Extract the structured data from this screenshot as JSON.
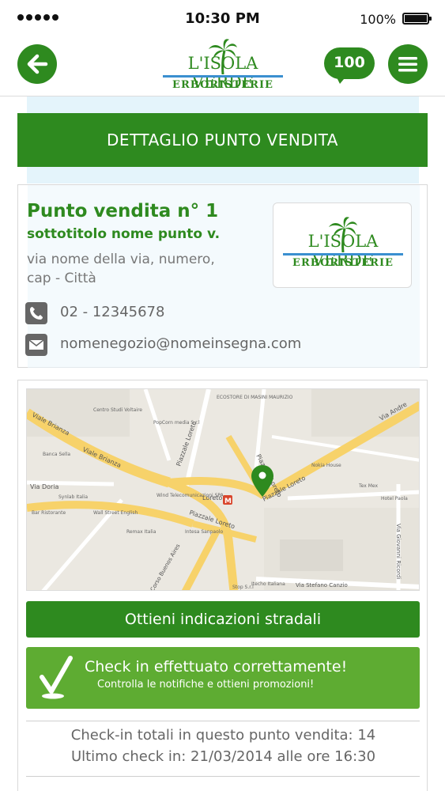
{
  "status_bar": {
    "time": "10:30 PM",
    "battery": "100%"
  },
  "header": {
    "brand_top": "L'ISOLA VERDE",
    "brand_bottom": "ERBORISTERIE",
    "notification_count": "100"
  },
  "page": {
    "title": "DETTAGLIO PUNTO VENDITA"
  },
  "store": {
    "name": "Punto vendita n° 1",
    "subtitle": "sottotitolo nome punto v.",
    "address_line1": "via nome della via, numero,",
    "address_line2": "cap - Città",
    "phone": "02 - 12345678",
    "email": "nomenegozio@nomeinsegna.com"
  },
  "map": {
    "labels": {
      "viale_brianza": "Viale Brianza",
      "viale_brianza_2": "Viale Brianza",
      "via_andrea": "Via Andre",
      "piazzale_loreto": "Piazzale Loreto",
      "piazzale_loreto_2": "Piazzale Loreto",
      "piazzale_loreto_3": "Piazzale Loreto",
      "piazzale_loreto_4": "Piazzale Loreto",
      "loreto": "Loreto",
      "via_doria": "Via Doria",
      "corso_buenos_aires": "Corso Buenos Aires",
      "via_giovanni_ricordi": "Via Giovanni Ricordi",
      "via_stefano_canzio": "Via Stefano Canzio",
      "centro_studi": "Centro Studi Voltaire",
      "hotel_paola": "Hotel Paola",
      "tex_mex": "Tex Mex",
      "wall_street": "Wall Street English",
      "banca_sella": "Banca Sella",
      "intesa": "Intesa Sanpaolo",
      "popcorn": "PopCorn media S.r.l",
      "ecostore": "ECOSTORE DI MASINI MAURIZIO",
      "synlab": "Synlab Italia",
      "bar_ristorante": "Bar Ristorante",
      "remax": "Remax Italia",
      "wind": "Wind Telecomunicazioni SPA",
      "nokia": "Nokia House",
      "stop": "Stop S.r.l",
      "itecho": "Itecho Italiana",
      "metro_m": "M"
    }
  },
  "actions": {
    "directions_label": "Ottieni indicazioni stradali",
    "checkin_title": "Check in effettuato correttamente!",
    "checkin_subtitle": "Controlla le notifiche e ottieni promozioni!"
  },
  "stats": {
    "total_checkins": "Check-in totali in questo punto vendita: 14",
    "last_checkin": "Ultimo check in: 21/03/2014 alle ore 16:30"
  },
  "colors": {
    "brand_green": "#2e8a1f",
    "light_green": "#5eac32",
    "brand_blue": "#3a8fd0",
    "road_yellow": "#f7d26a"
  }
}
